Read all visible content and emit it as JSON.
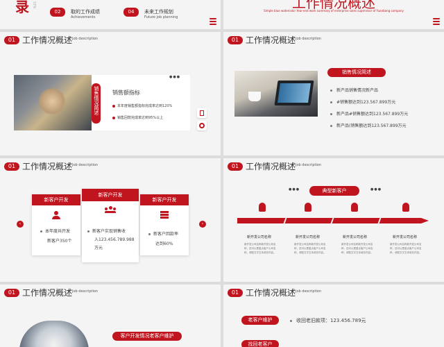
{
  "top_left": {
    "big_char": "录",
    "vertical_tag": "STN",
    "items": [
      {
        "num": "02",
        "title": "取的工作成绩",
        "sub": "Achievements"
      },
      {
        "num": "04",
        "title": "未来工作规划",
        "sub": "Future job planning"
      }
    ]
  },
  "top_right": {
    "title": "工作情况概述",
    "sub": "Simple blue watercolor Year-end work summary of enterprise sales supervisor of Yuanbang company"
  },
  "header": {
    "num": "01",
    "title": "工作情况概述",
    "sub": "Job description"
  },
  "slide2": {
    "vertical_label": "销售情况简述",
    "heading": "销售额指标",
    "bullets": [
      "本年度销售额指标完成率达到120%",
      "销售回款完成率达到95%以上"
    ],
    "dots": "●●●"
  },
  "slide3": {
    "pill": "销售情况简述",
    "bullets": [
      "新产品销售情况新产品",
      "#销售额达到123.567.899万元",
      "新产品#销售额达到123.567.899万元",
      "新产品(销售额达到123.567.899万元"
    ]
  },
  "slide4": {
    "cards": [
      {
        "head": "新客户开发",
        "lines": [
          "本年度共开发",
          "新客户350个"
        ]
      },
      {
        "head": "新客户开发",
        "lines": [
          "新客户实现销售收",
          "入123.456.789.988",
          "万元"
        ]
      },
      {
        "head": "新客户开发",
        "lines": [
          "新客户回款率",
          "达到60%"
        ]
      }
    ]
  },
  "slide5": {
    "pill": "典型新客户",
    "columns": [
      {
        "title": "新开发公司名称",
        "text": [
          "新开发公司名称新开发公司名",
          "称，还可以是重点客户公司名",
          "称，请配文字文本填充内容。"
        ]
      },
      {
        "title": "新开发公司名称",
        "text": [
          "新开发公司名称新开发公司名",
          "称，还可以是重点客户公司名",
          "称，请配文字文本填充内容。"
        ]
      },
      {
        "title": "新开发公司名称",
        "text": [
          "新开发公司名称新开发公司名",
          "称，还可以是重点客户公司名",
          "称，请配文字文本填充内容。"
        ]
      },
      {
        "title": "新开发公司名称",
        "text": [
          "新开发公司名称新开发公司名",
          "称，还可以是重点客户公司名",
          "称，请配文字文本填充内容。"
        ]
      }
    ]
  },
  "slide6": {
    "pill": "客户开发情况老客户维护"
  },
  "slide7": {
    "pill1": "老客户维护",
    "bullet": "收回老旧款项：123.456.789元",
    "pill2": "找回老客户"
  },
  "colors": {
    "accent": "#c0141e",
    "background": "#f4f4f4"
  }
}
